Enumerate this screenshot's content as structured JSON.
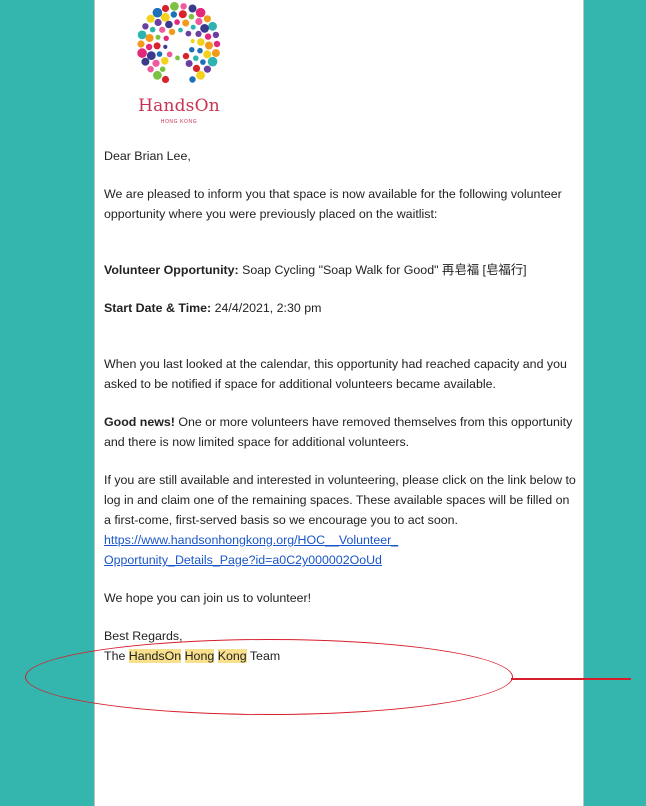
{
  "colors": {
    "teal": "#34b5ae",
    "brand_red": "#c8344f",
    "link": "#1a56c9",
    "highlight": "#f8e08c",
    "annotation_red": "#d71f2b"
  },
  "logo": {
    "name": "HandsOn",
    "sub": "HONG KONG",
    "icon": "handson-dots-logo"
  },
  "email": {
    "greeting": "Dear Brian Lee,",
    "intro": "We are pleased to inform you that space is now available for the following volunteer opportunity where you were previously placed on the waitlist:",
    "opportunity_label": "Volunteer Opportunity:",
    "opportunity_value": " Soap Cycling \"Soap Walk for Good\" 再皂福 [皂福行]",
    "start_label": "Start Date & Time:",
    "start_value": " 24/4/2021, 2:30 pm",
    "calendar_note": "When you last looked at the calendar, this opportunity had reached capacity and you asked to be notified if space for additional volunteers became available.",
    "good_news_label": "Good news!",
    "good_news_text": " One or more volunteers have removed themselves from this opportunity and there is now limited space for additional volunteers.",
    "instructions": "If you are still available and interested in volunteering, please click on the link below to log in and claim one of the remaining spaces. These available spaces will be filled on a first-come, first-served basis so we encourage you to act soon.",
    "link_line1": "https://www.handsonhongkong.org/HOC__Volunteer_",
    "link_line2": "Opportunity_Details_Page?id=a0C2y000002OoUd",
    "closing": "We hope you can join us to volunteer!",
    "regards": "Best Regards,",
    "signature_prefix": "The ",
    "signature_w1": "HandsOn",
    "signature_w2": "Hong",
    "signature_w3": "Kong",
    "signature_suffix": " Team"
  }
}
